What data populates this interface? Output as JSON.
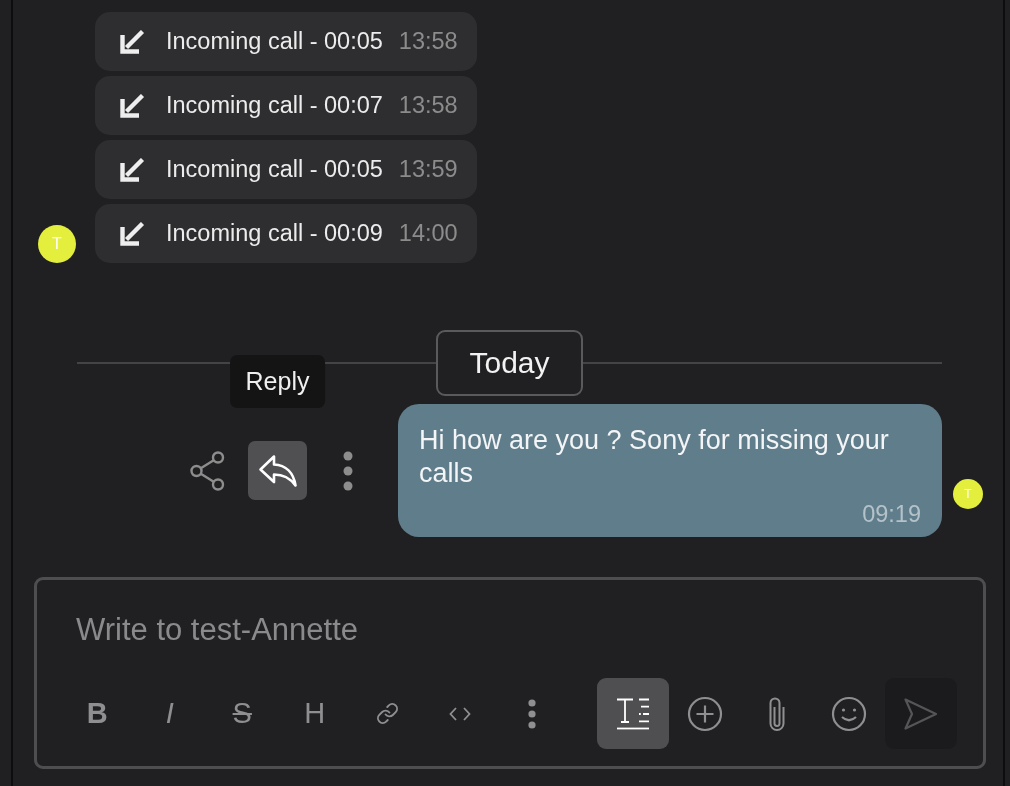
{
  "call_log": {
    "avatar": "T",
    "calls": [
      {
        "label": "Incoming call - 00:05",
        "time": "13:58"
      },
      {
        "label": "Incoming call - 00:07",
        "time": "13:58"
      },
      {
        "label": "Incoming call - 00:05",
        "time": "13:59"
      },
      {
        "label": "Incoming call - 00:09",
        "time": "14:00"
      }
    ]
  },
  "date_divider": {
    "label": "Today"
  },
  "message": {
    "actions": [
      {
        "kind": "share",
        "highlighted": false
      },
      {
        "kind": "reply",
        "highlighted": true,
        "tooltip": "Reply"
      },
      {
        "kind": "more",
        "highlighted": false
      }
    ],
    "text": "Hi how are you ? Sony for missing your calls",
    "time": "09:19",
    "avatar": "T"
  },
  "composer": {
    "placeholder": "Write to test-Annette",
    "format_tools": [
      {
        "kind": "bold",
        "label": "B"
      },
      {
        "kind": "italic",
        "label": "I"
      },
      {
        "kind": "strike",
        "label": "S"
      },
      {
        "kind": "heading",
        "label": "H"
      },
      {
        "kind": "link"
      },
      {
        "kind": "code"
      },
      {
        "kind": "more"
      }
    ],
    "actions": [
      {
        "kind": "formatting",
        "on": true,
        "disabled": false
      },
      {
        "kind": "add",
        "on": false,
        "disabled": false
      },
      {
        "kind": "attach",
        "on": false,
        "disabled": false
      },
      {
        "kind": "emoji",
        "on": false,
        "disabled": false
      },
      {
        "kind": "send",
        "on": false,
        "disabled": true
      }
    ]
  }
}
